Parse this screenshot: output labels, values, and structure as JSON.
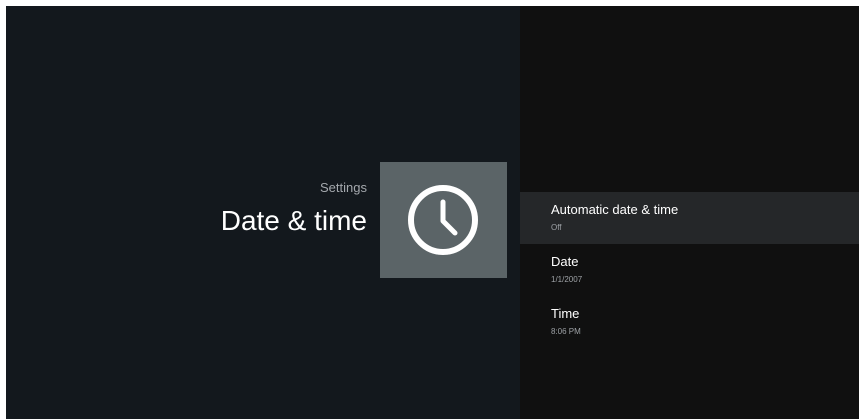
{
  "header": {
    "breadcrumb": "Settings",
    "title": "Date & time",
    "icon": "clock-icon"
  },
  "settings_list": {
    "items": [
      {
        "label": "Automatic date & time",
        "value": "Off",
        "selected": true
      },
      {
        "label": "Date",
        "value": "1/1/2007",
        "selected": false
      },
      {
        "label": "Time",
        "value": "8:06 PM",
        "selected": false
      }
    ]
  },
  "colors": {
    "left_background": "#13181d",
    "right_background": "#101010",
    "icon_tile": "#5b6467",
    "selected_row": "#252729",
    "primary_text": "#ffffff",
    "secondary_text": "#9ea2a6"
  }
}
